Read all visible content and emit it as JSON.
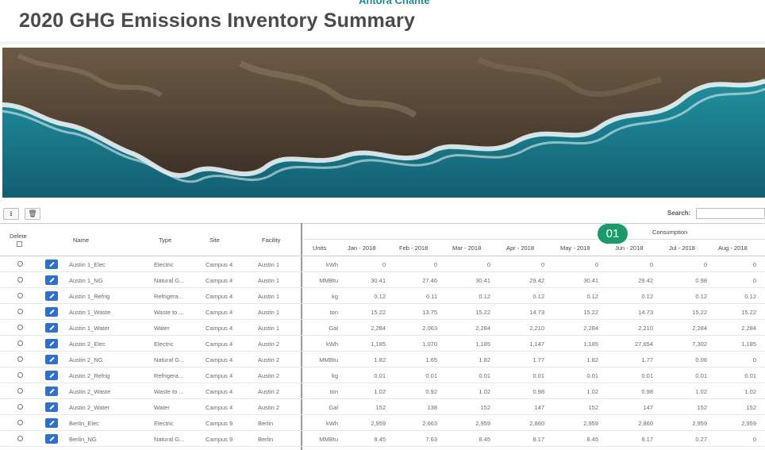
{
  "cut_header_text": "Antora Chante",
  "page_title": "2020 GHG Emissions Inventory Summary",
  "toolbar": {
    "export_icon": "download-icon",
    "delete_icon": "trash-icon",
    "search_label": "Search:",
    "search_value": ""
  },
  "badge_label": "01",
  "table": {
    "left_headers": {
      "delete": "Delete",
      "name": "Name",
      "type": "Type",
      "site": "Site",
      "facility": "Facility"
    },
    "consumption_label": "Consumption",
    "right_headers": [
      "Units",
      "Jan - 2018",
      "Feb - 2018",
      "Mar - 2018",
      "Apr - 2018",
      "May - 2018",
      "Jun - 2018",
      "Jul - 2018",
      "Aug - 2018"
    ],
    "rows": [
      {
        "name": "Austin 1_Elec",
        "type": "Electric",
        "site": "Campus 4",
        "facility": "Austin 1",
        "units": "kWh",
        "values": [
          "0",
          "0",
          "0",
          "0",
          "0",
          "0",
          "0",
          "0"
        ]
      },
      {
        "name": "Austin 1_NG",
        "type": "Natural G...",
        "site": "Campus 4",
        "facility": "Austin 1",
        "units": "MMBtu",
        "values": [
          "30.41",
          "27.46",
          "30.41",
          "29.42",
          "30.41",
          "29.42",
          "0.98",
          "0"
        ]
      },
      {
        "name": "Austin 1_Refrig",
        "type": "Refrigera...",
        "site": "Campus 4",
        "facility": "Austin 1",
        "units": "kg",
        "values": [
          "0.12",
          "0.11",
          "0.12",
          "0.12",
          "0.12",
          "0.12",
          "0.12",
          "0.12"
        ]
      },
      {
        "name": "Austin 1_Waste",
        "type": "Waste to ...",
        "site": "Campus 4",
        "facility": "Austin 1",
        "units": "ton",
        "values": [
          "15.22",
          "13.75",
          "15.22",
          "14.73",
          "15.22",
          "14.73",
          "15.22",
          "15.22"
        ]
      },
      {
        "name": "Austin 1_Water",
        "type": "Water",
        "site": "Campus 4",
        "facility": "Austin 1",
        "units": "Gal",
        "values": [
          "2,284",
          "2,063",
          "2,284",
          "2,210",
          "2,284",
          "2,210",
          "2,284",
          "2,284"
        ]
      },
      {
        "name": "Austin 2_Elec",
        "type": "Electric",
        "site": "Campus 4",
        "facility": "Austin 2",
        "units": "kWh",
        "values": [
          "1,185",
          "1,070",
          "1,185",
          "1,147",
          "1,185",
          "27,654",
          "7,302",
          "1,185"
        ]
      },
      {
        "name": "Austin 2_NG",
        "type": "Natural G...",
        "site": "Campus 4",
        "facility": "Austin 2",
        "units": "MMBtu",
        "values": [
          "1.82",
          "1.65",
          "1.82",
          "1.77",
          "1.82",
          "1.77",
          "0.06",
          "0"
        ]
      },
      {
        "name": "Austin 2_Refrig",
        "type": "Refrigera...",
        "site": "Campus 4",
        "facility": "Austin 2",
        "units": "kg",
        "values": [
          "0.01",
          "0.01",
          "0.01",
          "0.01",
          "0.01",
          "0.01",
          "0.01",
          "0.01"
        ]
      },
      {
        "name": "Austin 2_Waste",
        "type": "Waste to ...",
        "site": "Campus 4",
        "facility": "Austin 2",
        "units": "ton",
        "values": [
          "1.02",
          "0.92",
          "1.02",
          "0.98",
          "1.02",
          "0.98",
          "1.02",
          "1.02"
        ]
      },
      {
        "name": "Austin 2_Water",
        "type": "Water",
        "site": "Campus 4",
        "facility": "Austin 2",
        "units": "Gal",
        "values": [
          "152",
          "138",
          "152",
          "147",
          "152",
          "147",
          "152",
          "152"
        ]
      },
      {
        "name": "Berlin_Elec",
        "type": "Electric",
        "site": "Campus 9",
        "facility": "Berlin",
        "units": "kWh",
        "values": [
          "2,959",
          "2,663",
          "2,959",
          "2,860",
          "2,959",
          "2,860",
          "2,959",
          "2,959"
        ]
      },
      {
        "name": "Berlin_NG",
        "type": "Natural G...",
        "site": "Campus 9",
        "facility": "Berlin",
        "units": "MMBtu",
        "values": [
          "8.45",
          "7.63",
          "8.45",
          "8.17",
          "8.45",
          "8.17",
          "0.27",
          "0"
        ]
      }
    ]
  },
  "colors": {
    "title_gray": "#4a4a4a",
    "edit_blue": "#2f6fcf",
    "badge_green": "#1a9c6a",
    "sea_teal": "#1f8f9c"
  }
}
